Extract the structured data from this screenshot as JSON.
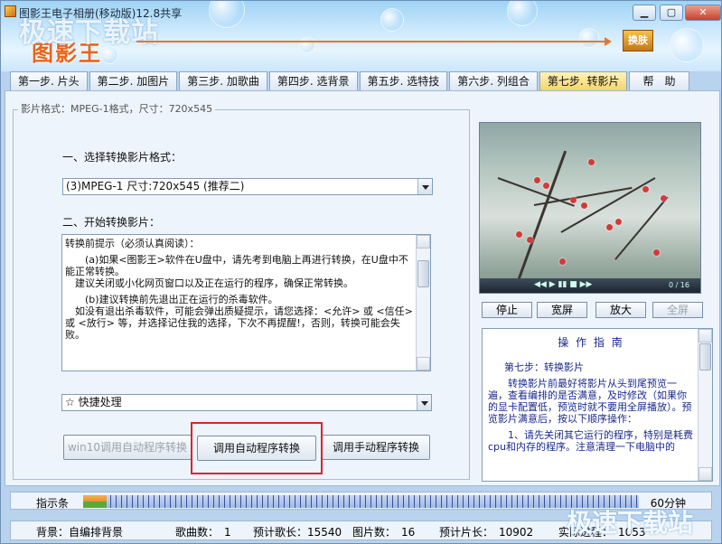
{
  "window": {
    "title": "图影王电子相册(移动版)12.8共享",
    "logo": "图影王",
    "watermark": "极速下载站",
    "skin_label": "换肤"
  },
  "tabs": [
    {
      "label": "第一步. 片头"
    },
    {
      "label": "第二步. 加图片"
    },
    {
      "label": "第三步. 加歌曲"
    },
    {
      "label": "第四步. 选背景"
    },
    {
      "label": "第五步. 选特技"
    },
    {
      "label": "第六步. 列组合"
    },
    {
      "label": "第七步. 转影片"
    },
    {
      "label": "帮　助"
    }
  ],
  "main": {
    "format_info": "影片格式：MPEG-1格式，尺寸：720x545",
    "step1_label": "一、选择转换影片格式：",
    "format_selected": "(3)MPEG-1 尺寸:720x545 (推荐二)",
    "step2_label": "二、开始转换影片：",
    "notice": [
      "转换前提示（必须认真阅读）：",
      "　　(a)如果<图影王>软件在U盘中，请先考到电脑上再进行转换，在U盘中不能正常转换。\n　建议关闭或小化网页窗口以及正在运行的程序，确保正常转换。",
      "　　(b)建议转换前先退出正在运行的杀毒软件。\n　如没有退出杀毒软件，可能会弹出质疑提示，请您选择：<允许> 或 <信任> 或 <放行> 等，并选择记住我的选择，下次不再提醒!，否则，转换可能会失败。"
    ],
    "quick_selected": "☆ 快捷处理",
    "btn_win10": "win10调用自动程序转换",
    "btn_auto": "调用自动程序转换",
    "btn_manual": "调用手动程序转换"
  },
  "preview": {
    "btn_stop": "停止",
    "btn_wide": "宽屏",
    "btn_zoom": "放大",
    "btn_full": "全屏",
    "time": "0 / 16"
  },
  "guide": {
    "title": "操 作 指 南",
    "step": "第七步：转换影片",
    "p1": "　　转换影片前最好将影片从头到尾预览一遍，查看编排的是否满意，及时修改（如果你的显卡配置低，预览时就不要用全屏播放）。预览影片满意后，按以下顺序操作：",
    "p2": "　　1、请先关闭其它运行的程序，特别是耗费cpu和内存的程序。注意清理一下电脑中的"
  },
  "indicator": {
    "label": "指示条",
    "duration": "60分钟"
  },
  "status": {
    "bg": "背景：自编排背景",
    "songs": "歌曲数：　1",
    "song_len": "预计歌长：15540",
    "pics": "图片数：　16",
    "film_len": "预计片长：　10902",
    "actual": "实际进程：　1053"
  }
}
